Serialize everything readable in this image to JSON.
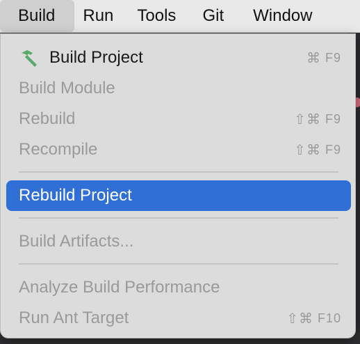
{
  "menubar": {
    "items": [
      "Build",
      "Run",
      "Tools",
      "Git",
      "Window"
    ]
  },
  "build_menu": {
    "build_project": {
      "label": "Build Project",
      "shortcut_symbol": "⌘",
      "shortcut_key": "F9"
    },
    "build_module": {
      "label": "Build Module"
    },
    "rebuild": {
      "label": "Rebuild",
      "shortcut_symbol": "⇧⌘",
      "shortcut_key": "F9"
    },
    "recompile": {
      "label": "Recompile",
      "shortcut_symbol": "⇧⌘",
      "shortcut_key": "F9"
    },
    "rebuild_project": {
      "label": "Rebuild Project"
    },
    "build_artifacts": {
      "label": "Build Artifacts..."
    },
    "analyze_build_performance": {
      "label": "Analyze Build Performance"
    },
    "run_ant_target": {
      "label": "Run Ant Target",
      "shortcut_symbol": "⇧⌘",
      "shortcut_key": "F10"
    }
  },
  "colors": {
    "highlight": "#2f6fd6",
    "hammer_icon": "#5aa86a"
  }
}
